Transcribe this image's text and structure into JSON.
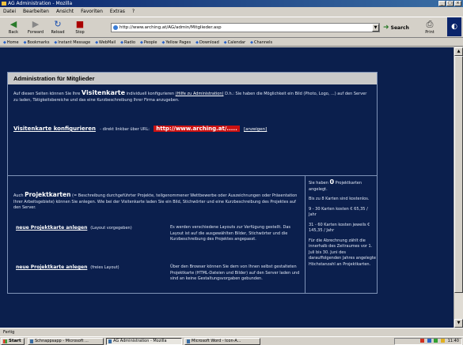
{
  "window": {
    "title": "AG Administration - Mozilla",
    "controls": [
      "_",
      "□",
      "×"
    ]
  },
  "menu": [
    "Datei",
    "Bearbeiten",
    "Ansicht",
    "Favoriten",
    "Extras",
    "?"
  ],
  "toolbar": {
    "back_label": "Back",
    "forward_label": "Forward",
    "reload_label": "Reload",
    "stop_label": "Stop",
    "address_value": "http://www.arching.at/AG/admin/Mitglieder.asp",
    "search_label": "Search",
    "print_label": "Print"
  },
  "links": [
    "Home",
    "Bookmarks",
    "Instant Message",
    "WebMail",
    "Radio",
    "People",
    "Yellow Pages",
    "Download",
    "Calendar",
    "Channels"
  ],
  "content": {
    "header_title": "Administration für Mitglieder",
    "intro_text_1": "Auf diesen Seiten können Sie Ihre",
    "intro_big_1": "Visitenkarte",
    "intro_text_2": "individuell konfigurieren",
    "intro_link": "(Hilfe zu Administration)",
    "intro_text_3": "D.h.: Sie haben die Möglichkeit ein Bild (Photo, Logo, ...) auf den Server zu laden, Tätigkeitsbereiche und das eine Kurzbeschreibung Ihrer Firma anzugeben.",
    "vk_link": "Visitenkarte konfigurieren",
    "vk_direct": "- direkt linkbar über URL:",
    "vk_url": "http://www.arching.at/.....",
    "vk_show": "[anzeigen]",
    "proj_text_1": "Auch",
    "proj_big": "Projektkarten",
    "proj_text_2": "(= Beschreibung durchgeführter Projekte, teilgenommener Wettbewerbe oder Auszeichnungen oder Präsentation Ihrer Arbeitsgebiete) können Sie anlegen. Wie bei der Visitenkarte laden Sie ein Bild, Stichwörter und eine Kurzbeschreibung des Projektes auf den Server.",
    "action_1_link": "neue Projektkarte anlegen",
    "action_1_note": "(Layout vorgegeben)",
    "action_1_desc": "Es werden verschiedene Layouts zur Verfügung gestellt. Das Layout ist auf die ausgewählten Bilder, Stichwörter und die Kurzbeschreibung des Projektes angepasst.",
    "action_2_link": "neue Projektkarte anlegen",
    "action_2_note": "(freies Layout)",
    "action_2_desc": "Über den Browser können Sie dem von Ihnen selbst gestalteten Projektkarte (HTML-Dateien und Bilder) auf den Server laden und sind an keine Gestaltungsvorgaben gebunden.",
    "side_text_1": "Sie haben",
    "side_count": "0",
    "side_text_2": "Projektkarten angelegt.",
    "side_text_3": "Bis zu 8 Karten sind kostenlos.",
    "side_text_4": "9 - 30 Karten kosten € 65,35 / Jahr",
    "side_text_5": "31 - 60 Karten kosten jeweils € 145,35 / Jahr",
    "side_text_6": "Für die Abrechnung zählt die innerhalb des Zeitraumes vor 1. Juli bis 30. Juni des darauffolgenden Jahres angelegte Höchstanzahl an Projektkarten."
  },
  "status": "Fertig",
  "taskbar": {
    "start_label": "Start",
    "items": [
      "Schnappsapp - Microsoft ...",
      "AG Administration - Mozilla",
      "Microsoft Word - Icon-A..."
    ],
    "clock": "11:40"
  }
}
